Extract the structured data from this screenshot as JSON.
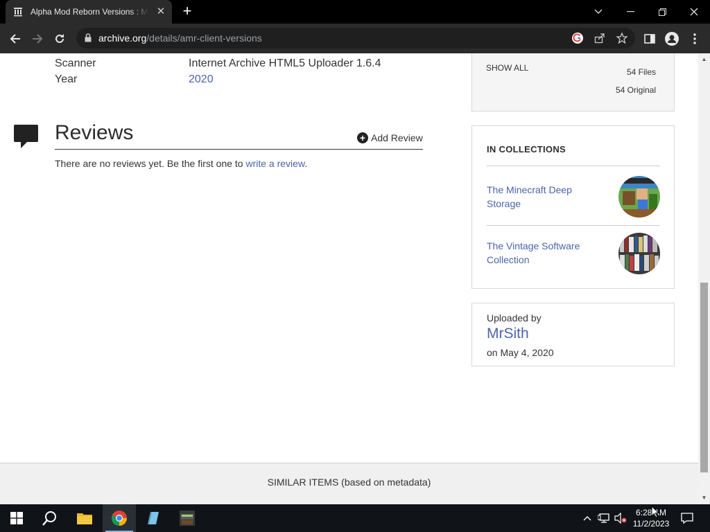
{
  "browser": {
    "tab_title": "Alpha Mod Reborn Versions : Mr",
    "url_domain": "archive.org",
    "url_path": "/details/amr-client-versions"
  },
  "metadata": {
    "scanner_label": "Scanner",
    "scanner_value": "Internet Archive HTML5 Uploader 1.6.4",
    "year_label": "Year",
    "year_value": "2020"
  },
  "reviews": {
    "title": "Reviews",
    "add_label": "Add Review",
    "empty_text": "There are no reviews yet. Be the first one to",
    "write_link": "write a review",
    "period": "."
  },
  "files_panel": {
    "show_all": "SHOW ALL",
    "files": "54 Files",
    "original": "54 Original"
  },
  "collections": {
    "heading": "IN COLLECTIONS",
    "items": [
      {
        "label": "The Minecraft Deep Storage"
      },
      {
        "label": "The Vintage Software Collection"
      }
    ]
  },
  "uploader": {
    "label": "Uploaded by",
    "name": "MrSith",
    "date": "on May 4, 2020"
  },
  "similar": {
    "label": "SIMILAR ITEMS (based on metadata)"
  },
  "taskbar": {
    "time": "6:28 AM",
    "date": "11/2/2023"
  }
}
